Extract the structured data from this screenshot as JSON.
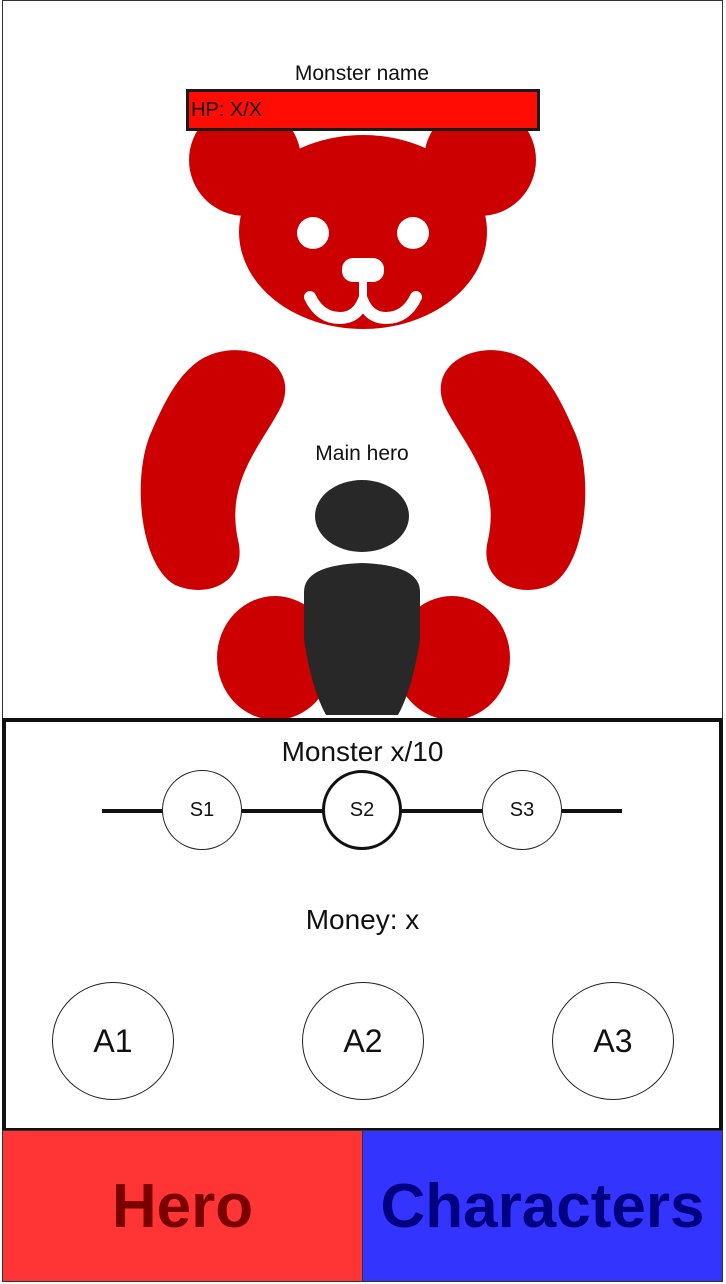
{
  "monster": {
    "name": "Monster name",
    "hp_text": "HP: X/X",
    "color": "#cc0000",
    "hp_bar_color": "#ff0c04"
  },
  "hero": {
    "label": "Main hero",
    "color": "#282828"
  },
  "stage_panel": {
    "title": "Monster x/10",
    "stages": [
      {
        "label": "S1",
        "active": false
      },
      {
        "label": "S2",
        "active": true
      },
      {
        "label": "S3",
        "active": false
      }
    ],
    "money": "Money: x",
    "abilities": [
      {
        "label": "A1"
      },
      {
        "label": "A2"
      },
      {
        "label": "A3"
      }
    ]
  },
  "tabs": [
    {
      "label": "Hero",
      "bg": "#ff3535",
      "fg": "#7a0000"
    },
    {
      "label": "Characters",
      "bg": "#3434ff",
      "fg": "#000080"
    }
  ]
}
